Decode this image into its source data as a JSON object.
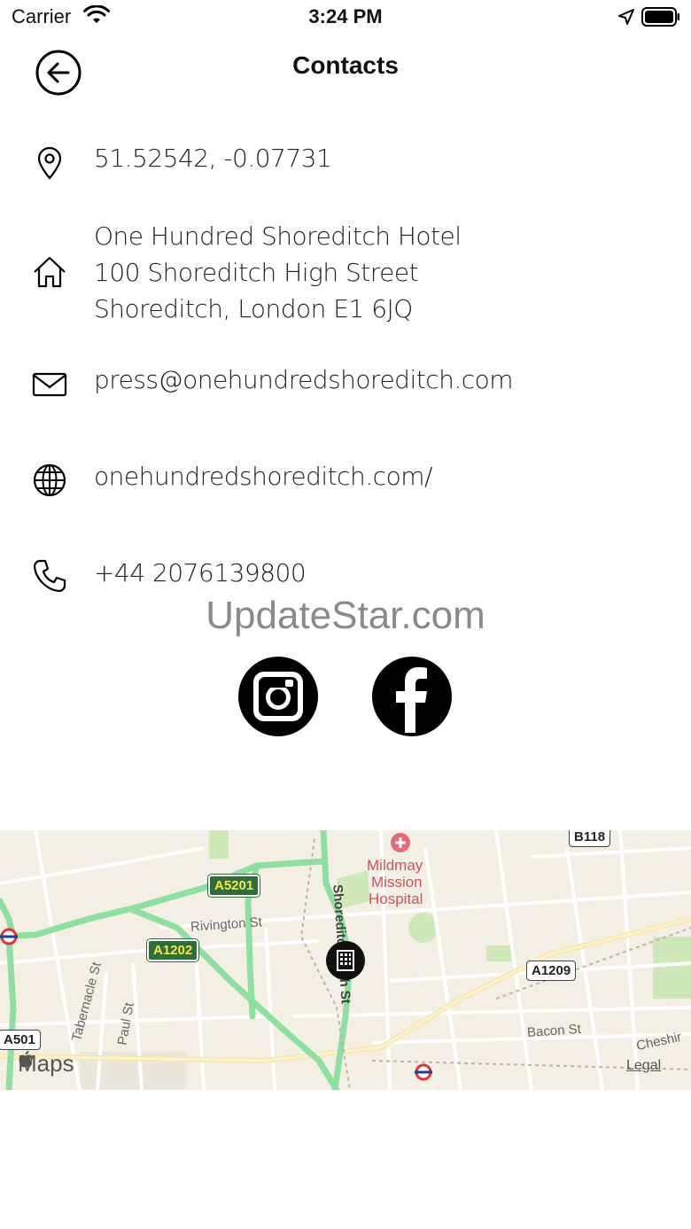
{
  "status_bar": {
    "carrier": "Carrier",
    "time": "3:24 PM"
  },
  "nav": {
    "title": "Contacts",
    "back_icon": "back-arrow-circle-icon"
  },
  "contacts": {
    "location": {
      "icon": "location-pin-icon",
      "text": "51.52542, -0.07731"
    },
    "address": {
      "icon": "home-icon",
      "lines": [
        "One Hundred Shoreditch Hotel",
        "100 Shoreditch High Street",
        "Shoreditch, London E1 6JQ"
      ]
    },
    "email": {
      "icon": "envelope-icon",
      "text": "press@onehundredshoreditch.com"
    },
    "website": {
      "icon": "globe-icon",
      "text": "onehundredshoreditch.com/"
    },
    "phone": {
      "icon": "phone-icon",
      "text": "+44 2076139800"
    }
  },
  "watermark": "UpdateStar.com",
  "social": {
    "instagram_icon": "instagram-icon",
    "facebook_icon": "facebook-icon"
  },
  "map": {
    "labels": {
      "rivington": "Rivington St",
      "shoreditch_st": "Shoreditch High St",
      "tabernacle": "Tabernacle St",
      "paul": "Paul St",
      "bacon": "Bacon St",
      "cheshire": "Cheshir"
    },
    "hospital": [
      "Mildmay",
      "Mission",
      "Hospital"
    ],
    "shields": {
      "a5201": "A5201",
      "a1202": "A1202",
      "a1209": "A1209",
      "b118": "B118",
      "a501": "A501"
    },
    "logo": "Maps",
    "legal": "Legal",
    "colors": {
      "background": "#f4efe4",
      "main_road": "#8fe0a0",
      "park": "#cfe8b9",
      "pin": "#111111"
    }
  }
}
